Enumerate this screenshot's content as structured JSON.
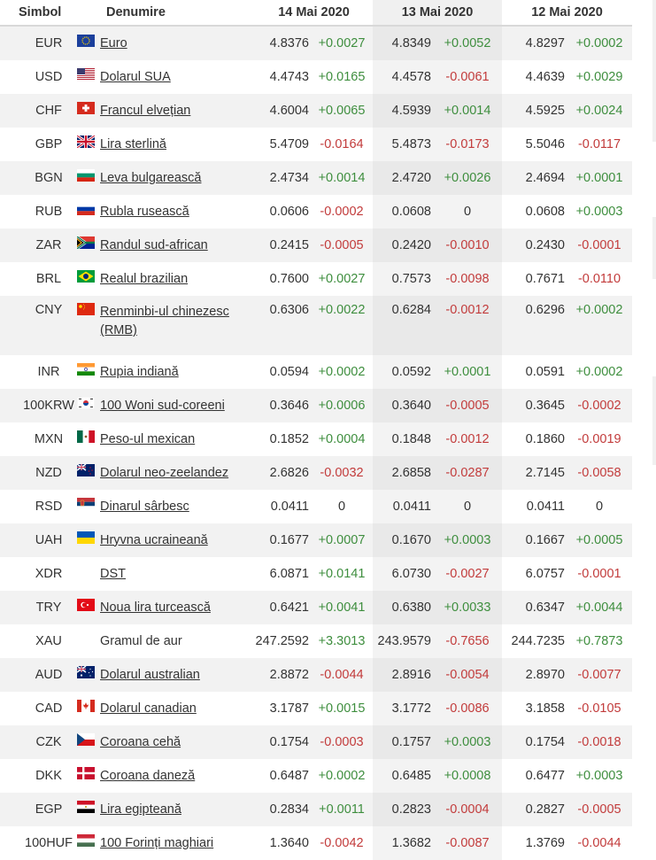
{
  "header": {
    "symbol": "Simbol",
    "name": "Denumire",
    "dates": [
      "14 Mai 2020",
      "13 Mai 2020",
      "12 Mai 2020"
    ]
  },
  "rows": [
    {
      "sym": "EUR",
      "name": "Euro",
      "flag": "eu-flag-icon",
      "r1": "4.8376",
      "d1": "+0.0027",
      "r2": "4.8349",
      "d2": "+0.0052",
      "r3": "4.8297",
      "d3": "+0.0002"
    },
    {
      "sym": "USD",
      "name": "Dolarul SUA",
      "flag": "us-flag-icon",
      "r1": "4.4743",
      "d1": "+0.0165",
      "r2": "4.4578",
      "d2": "-0.0061",
      "r3": "4.4639",
      "d3": "+0.0029"
    },
    {
      "sym": "CHF",
      "name": "Francul elvețian",
      "flag": "ch-flag-icon",
      "r1": "4.6004",
      "d1": "+0.0065",
      "r2": "4.5939",
      "d2": "+0.0014",
      "r3": "4.5925",
      "d3": "+0.0024"
    },
    {
      "sym": "GBP",
      "name": "Lira sterlină",
      "flag": "gb-flag-icon",
      "r1": "5.4709",
      "d1": "-0.0164",
      "r2": "5.4873",
      "d2": "-0.0173",
      "r3": "5.5046",
      "d3": "-0.0117"
    },
    {
      "sym": "BGN",
      "name": "Leva bulgarească",
      "flag": "bg-flag-icon",
      "r1": "2.4734",
      "d1": "+0.0014",
      "r2": "2.4720",
      "d2": "+0.0026",
      "r3": "2.4694",
      "d3": "+0.0001"
    },
    {
      "sym": "RUB",
      "name": "Rubla rusească",
      "flag": "ru-flag-icon",
      "r1": "0.0606",
      "d1": "-0.0002",
      "r2": "0.0608",
      "d2": "0",
      "r3": "0.0608",
      "d3": "+0.0003"
    },
    {
      "sym": "ZAR",
      "name": "Randul sud-african",
      "flag": "za-flag-icon",
      "r1": "0.2415",
      "d1": "-0.0005",
      "r2": "0.2420",
      "d2": "-0.0010",
      "r3": "0.2430",
      "d3": "-0.0001"
    },
    {
      "sym": "BRL",
      "name": "Realul brazilian",
      "flag": "br-flag-icon",
      "r1": "0.7600",
      "d1": "+0.0027",
      "r2": "0.7573",
      "d2": "-0.0098",
      "r3": "0.7671",
      "d3": "-0.0110"
    },
    {
      "sym": "CNY",
      "name": "Renminbi-ul chinezesc (RMB)",
      "flag": "cn-flag-icon",
      "r1": "0.6306",
      "d1": "+0.0022",
      "r2": "0.6284",
      "d2": "-0.0012",
      "r3": "0.6296",
      "d3": "+0.0002",
      "tall": true
    },
    {
      "sym": "INR",
      "name": "Rupia indiană",
      "flag": "in-flag-icon",
      "r1": "0.0594",
      "d1": "+0.0002",
      "r2": "0.0592",
      "d2": "+0.0001",
      "r3": "0.0591",
      "d3": "+0.0002"
    },
    {
      "sym": "100KRW",
      "name": "100 Woni sud-coreeni",
      "flag": "kr-flag-icon",
      "r1": "0.3646",
      "d1": "+0.0006",
      "r2": "0.3640",
      "d2": "-0.0005",
      "r3": "0.3645",
      "d3": "-0.0002"
    },
    {
      "sym": "MXN",
      "name": "Peso-ul mexican",
      "flag": "mx-flag-icon",
      "r1": "0.1852",
      "d1": "+0.0004",
      "r2": "0.1848",
      "d2": "-0.0012",
      "r3": "0.1860",
      "d3": "-0.0019"
    },
    {
      "sym": "NZD",
      "name": "Dolarul neo-zeelandez",
      "flag": "nz-flag-icon",
      "r1": "2.6826",
      "d1": "-0.0032",
      "r2": "2.6858",
      "d2": "-0.0287",
      "r3": "2.7145",
      "d3": "-0.0058"
    },
    {
      "sym": "RSD",
      "name": "Dinarul sârbesc",
      "flag": "rs-flag-icon",
      "r1": "0.0411",
      "d1": "0",
      "r2": "0.0411",
      "d2": "0",
      "r3": "0.0411",
      "d3": "0"
    },
    {
      "sym": "UAH",
      "name": "Hryvna ucraineană",
      "flag": "ua-flag-icon",
      "r1": "0.1677",
      "d1": "+0.0007",
      "r2": "0.1670",
      "d2": "+0.0003",
      "r3": "0.1667",
      "d3": "+0.0005"
    },
    {
      "sym": "XDR",
      "name": "DST",
      "flag": "",
      "r1": "6.0871",
      "d1": "+0.0141",
      "r2": "6.0730",
      "d2": "-0.0027",
      "r3": "6.0757",
      "d3": "-0.0001"
    },
    {
      "sym": "TRY",
      "name": "Noua lira turcească",
      "flag": "tr-flag-icon",
      "r1": "0.6421",
      "d1": "+0.0041",
      "r2": "0.6380",
      "d2": "+0.0033",
      "r3": "0.6347",
      "d3": "+0.0044"
    },
    {
      "sym": "XAU",
      "name": "Gramul de aur",
      "flag": "",
      "r1": "247.2592",
      "d1": "+3.3013",
      "r2": "243.9579",
      "d2": "-0.7656",
      "r3": "244.7235",
      "d3": "+0.7873",
      "nolink": true
    },
    {
      "sym": "AUD",
      "name": "Dolarul australian",
      "flag": "au-flag-icon",
      "r1": "2.8872",
      "d1": "-0.0044",
      "r2": "2.8916",
      "d2": "-0.0054",
      "r3": "2.8970",
      "d3": "-0.0077"
    },
    {
      "sym": "CAD",
      "name": "Dolarul canadian",
      "flag": "ca-flag-icon",
      "r1": "3.1787",
      "d1": "+0.0015",
      "r2": "3.1772",
      "d2": "-0.0086",
      "r3": "3.1858",
      "d3": "-0.0105"
    },
    {
      "sym": "CZK",
      "name": "Coroana cehă",
      "flag": "cz-flag-icon",
      "r1": "0.1754",
      "d1": "-0.0003",
      "r2": "0.1757",
      "d2": "+0.0003",
      "r3": "0.1754",
      "d3": "-0.0018"
    },
    {
      "sym": "DKK",
      "name": "Coroana daneză",
      "flag": "dk-flag-icon",
      "r1": "0.6487",
      "d1": "+0.0002",
      "r2": "0.6485",
      "d2": "+0.0008",
      "r3": "0.6477",
      "d3": "+0.0003"
    },
    {
      "sym": "EGP",
      "name": "Lira egipteană",
      "flag": "eg-flag-icon",
      "r1": "0.2834",
      "d1": "+0.0011",
      "r2": "0.2823",
      "d2": "-0.0004",
      "r3": "0.2827",
      "d3": "-0.0005"
    },
    {
      "sym": "100HUF",
      "name": "100 Forinți maghiari",
      "flag": "hu-flag-icon",
      "r1": "1.3640",
      "d1": "-0.0042",
      "r2": "1.3682",
      "d2": "-0.0087",
      "r3": "1.3769",
      "d3": "-0.0044"
    }
  ],
  "colors": {
    "positive": "#3e8e3e",
    "negative": "#c23b3b"
  }
}
